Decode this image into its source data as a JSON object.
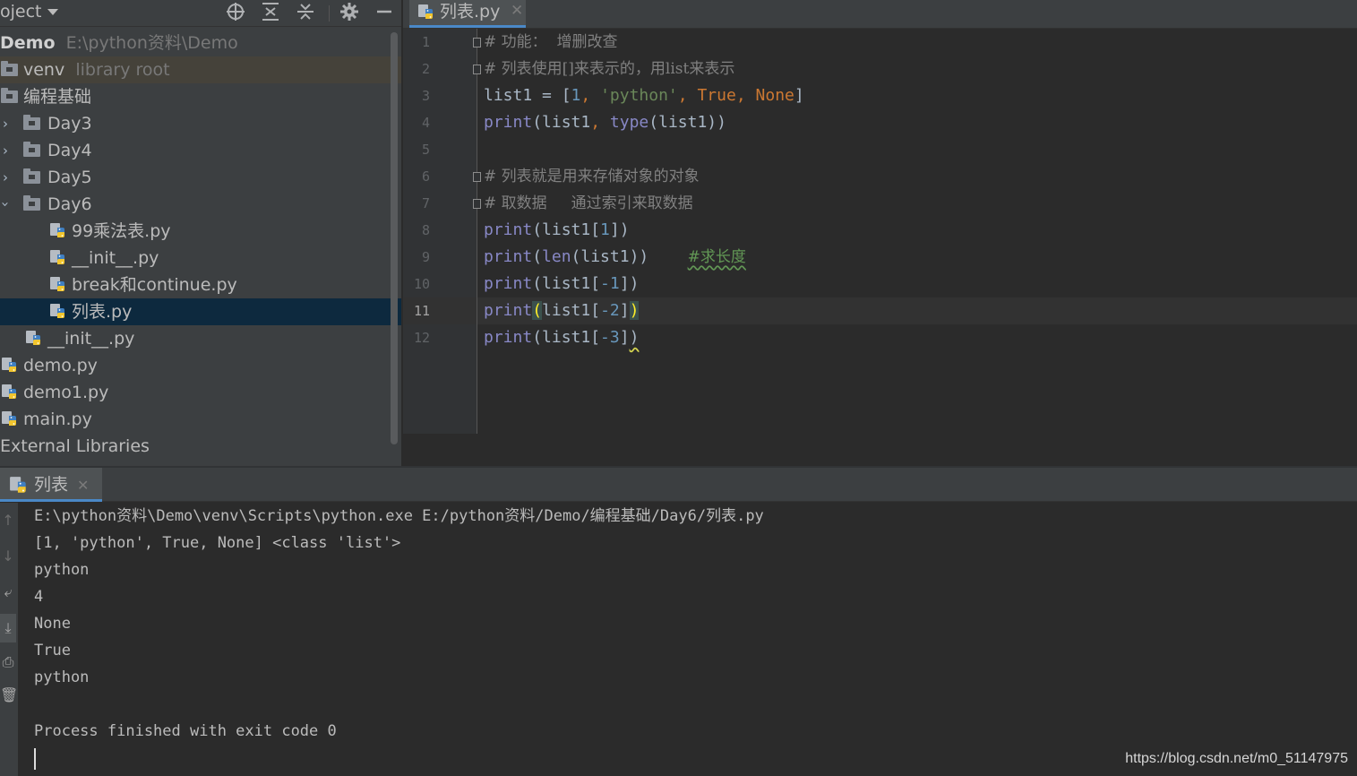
{
  "project_panel": {
    "title": "oject",
    "tree": [
      {
        "label": "Demo",
        "hint": "E:\\python资料\\Demo",
        "kind": "root"
      },
      {
        "label": "venv",
        "hint": "library root",
        "kind": "folder"
      },
      {
        "label": "编程基础",
        "kind": "folder"
      },
      {
        "label": "Day3",
        "kind": "folder",
        "expanded": false
      },
      {
        "label": "Day4",
        "kind": "folder",
        "expanded": false
      },
      {
        "label": "Day5",
        "kind": "folder",
        "expanded": false
      },
      {
        "label": "Day6",
        "kind": "folder",
        "expanded": true
      },
      {
        "label": "99乘法表.py",
        "kind": "py"
      },
      {
        "label": "__init__.py",
        "kind": "py"
      },
      {
        "label": "break和continue.py",
        "kind": "py"
      },
      {
        "label": "列表.py",
        "kind": "py",
        "selected": true
      },
      {
        "label": "__init__.py",
        "kind": "py"
      },
      {
        "label": "demo.py",
        "kind": "py"
      },
      {
        "label": "demo1.py",
        "kind": "py"
      },
      {
        "label": "main.py",
        "kind": "py"
      },
      {
        "label": "External Libraries",
        "kind": "libraries"
      }
    ]
  },
  "editor": {
    "tab": {
      "label": "列表.py",
      "close": "✕"
    },
    "current_line": 11,
    "lines": [
      {
        "n": "1",
        "comment": "# 功能：  增删改查"
      },
      {
        "n": "2",
        "comment": "# 列表使用[]来表示的，用list来表示"
      },
      {
        "n": "3",
        "p1": "list1 = [",
        "v1": "1",
        "c1": ", ",
        "v2": "'python'",
        "c2": ", ",
        "v3": "True",
        "c3": ", ",
        "v4": "None",
        "p2": "]"
      },
      {
        "n": "4",
        "f1": "print",
        "p1": "(list1",
        "c1": ", ",
        "f2": "type",
        "p2": "(list1))"
      },
      {
        "n": "5"
      },
      {
        "n": "6",
        "comment": "# 列表就是用来存储对象的对象"
      },
      {
        "n": "7",
        "comment": "# 取数据     通过索引来取数据"
      },
      {
        "n": "8",
        "f1": "print",
        "p1": "(list1[",
        "v1": "1",
        "p2": "])"
      },
      {
        "n": "9",
        "f1": "print",
        "p1": "(",
        "f2": "len",
        "p2": "(list1))",
        "sp": "    ",
        "typo": "#求长度"
      },
      {
        "n": "10",
        "f1": "print",
        "p1": "(list1[",
        "v1": "-1",
        "p2": "])"
      },
      {
        "n": "11",
        "f1": "print",
        "po": "(",
        "p1": "list1[",
        "v1": "-2",
        "p2": "]",
        "pc": ")"
      },
      {
        "n": "12",
        "f1": "print",
        "p1": "(list1[",
        "v1": "-3",
        "p2": "]",
        "sq": ")"
      }
    ]
  },
  "run_panel": {
    "tab": {
      "label": "列表",
      "close": "✕"
    },
    "output": [
      "E:\\python资料\\Demo\\venv\\Scripts\\python.exe E:/python资料/Demo/编程基础/Day6/列表.py",
      "[1, 'python', True, None] <class 'list'>",
      "python",
      "4",
      "None",
      "True",
      "python",
      "",
      "Process finished with exit code 0"
    ]
  },
  "watermark": "https://blog.csdn.net/m0_51147975",
  "colors": {
    "panel_bg": "#3c3f41",
    "editor_bg": "#2b2b2b",
    "selection": "#0d293e",
    "accent": "#4a88c7"
  }
}
